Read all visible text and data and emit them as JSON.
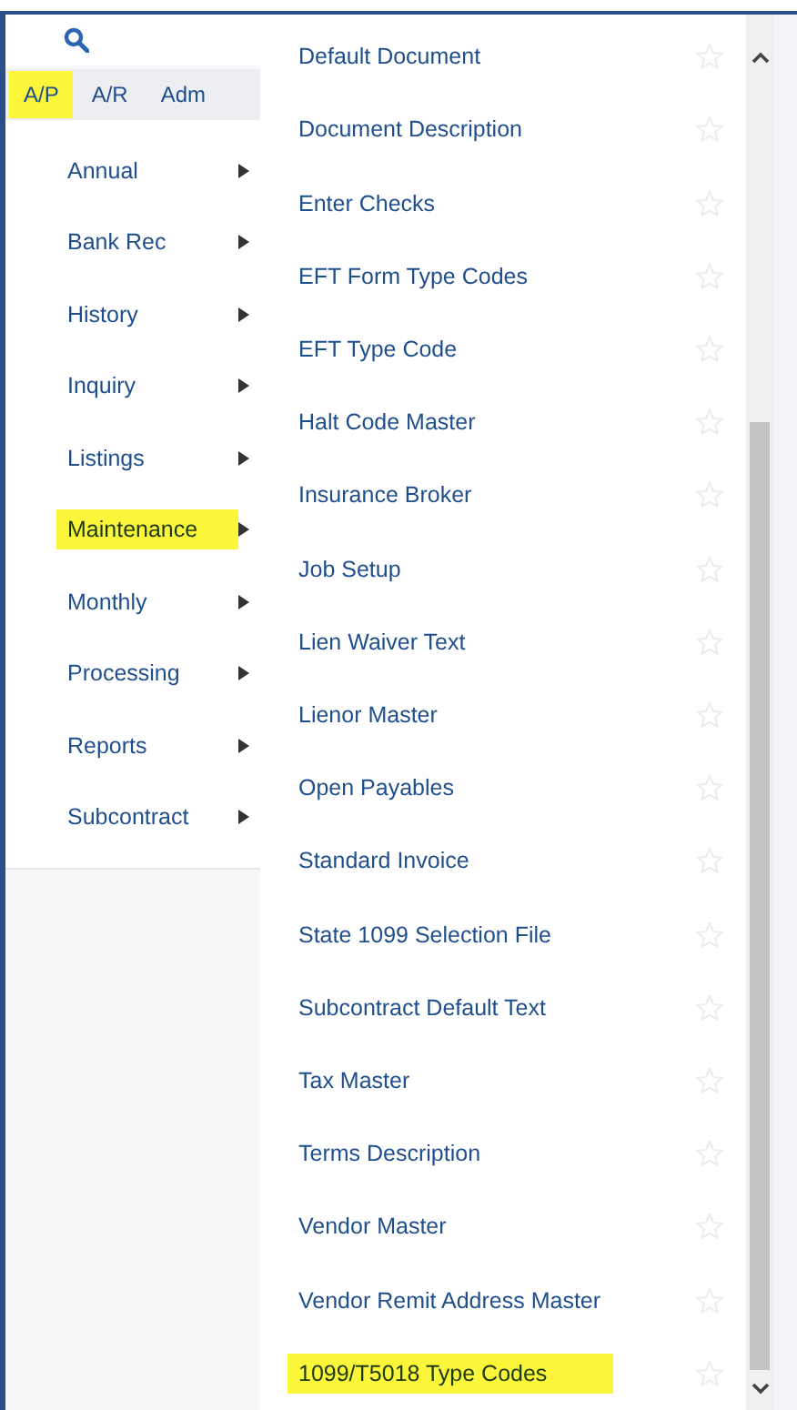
{
  "tabs": [
    {
      "label": "A/P",
      "highlighted": true
    },
    {
      "label": "A/R",
      "highlighted": false
    },
    {
      "label": "Adm",
      "highlighted": false
    }
  ],
  "menu": [
    {
      "label": "Annual",
      "highlighted": false
    },
    {
      "label": "Bank Rec",
      "highlighted": false
    },
    {
      "label": "History",
      "highlighted": false
    },
    {
      "label": "Inquiry",
      "highlighted": false
    },
    {
      "label": "Listings",
      "highlighted": false
    },
    {
      "label": "Maintenance",
      "highlighted": true
    },
    {
      "label": "Monthly",
      "highlighted": false
    },
    {
      "label": "Processing",
      "highlighted": false
    },
    {
      "label": "Reports",
      "highlighted": false
    },
    {
      "label": "Subcontract",
      "highlighted": false
    }
  ],
  "submenu": [
    {
      "label": "Default Document",
      "highlighted": false
    },
    {
      "label": "Document Description",
      "highlighted": false
    },
    {
      "label": "Enter Checks",
      "highlighted": false
    },
    {
      "label": "EFT Form Type Codes",
      "highlighted": false
    },
    {
      "label": "EFT Type Code",
      "highlighted": false
    },
    {
      "label": "Halt Code Master",
      "highlighted": false
    },
    {
      "label": "Insurance Broker",
      "highlighted": false
    },
    {
      "label": "Job Setup",
      "highlighted": false
    },
    {
      "label": "Lien Waiver Text",
      "highlighted": false
    },
    {
      "label": "Lienor Master",
      "highlighted": false
    },
    {
      "label": "Open Payables",
      "highlighted": false
    },
    {
      "label": "Standard Invoice",
      "highlighted": false
    },
    {
      "label": "State 1099 Selection File",
      "highlighted": false
    },
    {
      "label": "Subcontract Default Text",
      "highlighted": false
    },
    {
      "label": "Tax Master",
      "highlighted": false
    },
    {
      "label": "Terms Description",
      "highlighted": false
    },
    {
      "label": "Vendor Master",
      "highlighted": false
    },
    {
      "label": "Vendor Remit Address Master",
      "highlighted": false
    },
    {
      "label": "1099/T5018 Type Codes",
      "highlighted": true
    }
  ]
}
